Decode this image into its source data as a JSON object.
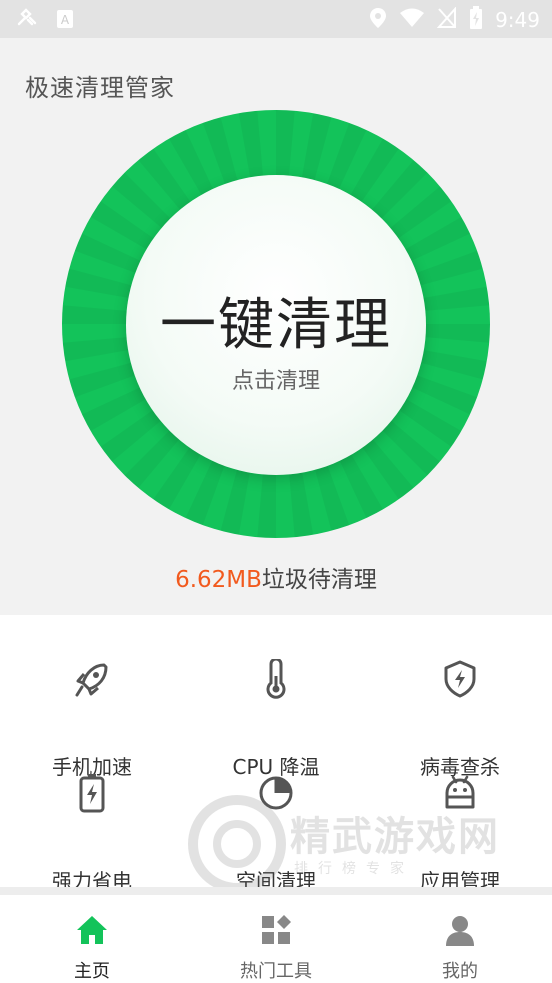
{
  "status_bar": {
    "time": "9:49"
  },
  "app": {
    "title": "极速清理管家"
  },
  "cleaner": {
    "main_label": "一键清理",
    "sub_label": "点击清理",
    "junk_amount": "6.62MB",
    "junk_suffix": "垃圾待清理"
  },
  "tools": [
    {
      "label": "手机加速",
      "icon": "rocket-icon"
    },
    {
      "label": "CPU 降温",
      "icon": "thermometer-icon"
    },
    {
      "label": "病毒查杀",
      "icon": "shield-icon"
    },
    {
      "label": "强力省电",
      "icon": "battery-icon"
    },
    {
      "label": "空间清理",
      "icon": "pie-chart-icon"
    },
    {
      "label": "应用管理",
      "icon": "android-icon"
    }
  ],
  "watermark": {
    "text": "精武游戏网",
    "subtext": "排行榜专家"
  },
  "nav": [
    {
      "label": "主页",
      "icon": "home-icon",
      "active": true
    },
    {
      "label": "热门工具",
      "icon": "grid-icon",
      "active": false
    },
    {
      "label": "我的",
      "icon": "user-icon",
      "active": false
    }
  ],
  "colors": {
    "accent": "#13c35a",
    "junk_amount": "#f25a1e",
    "icon": "#555555"
  }
}
